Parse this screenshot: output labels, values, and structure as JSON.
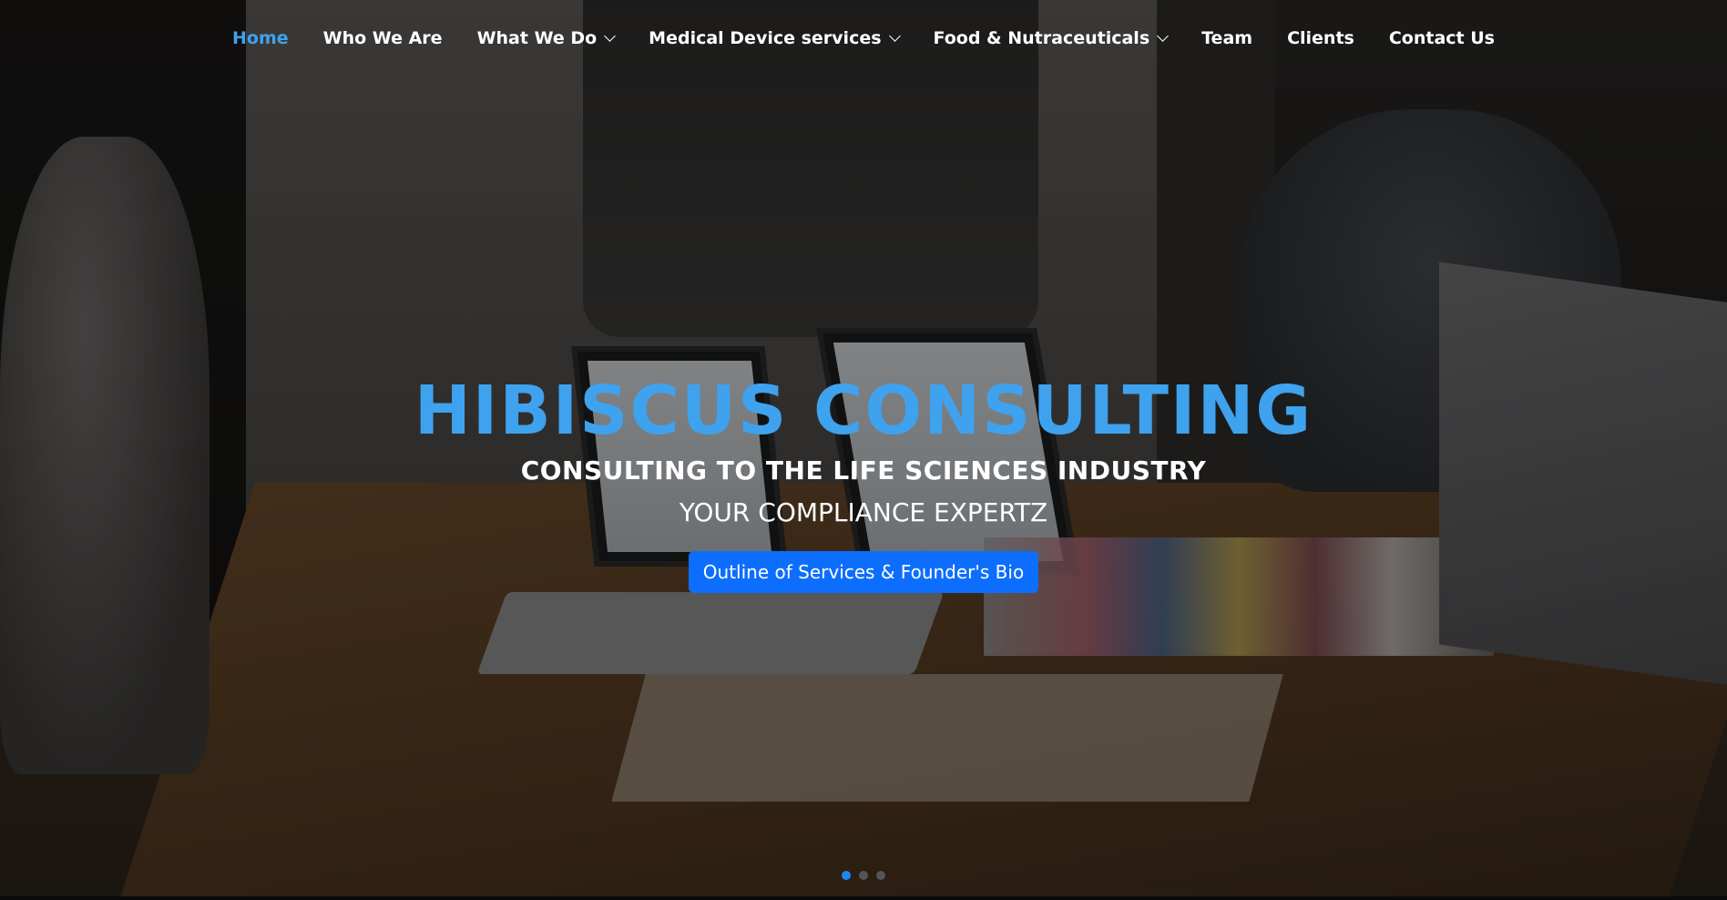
{
  "nav": {
    "items": [
      {
        "label": "Home",
        "active": true,
        "dropdown": false
      },
      {
        "label": "Who We Are",
        "active": false,
        "dropdown": false
      },
      {
        "label": "What We Do",
        "active": false,
        "dropdown": true
      },
      {
        "label": "Medical Device services",
        "active": false,
        "dropdown": true
      },
      {
        "label": "Food & Nutraceuticals",
        "active": false,
        "dropdown": true
      },
      {
        "label": "Team",
        "active": false,
        "dropdown": false
      },
      {
        "label": "Clients",
        "active": false,
        "dropdown": false
      },
      {
        "label": "Contact Us",
        "active": false,
        "dropdown": false
      }
    ]
  },
  "hero": {
    "title": "HIBISCUS CONSULTING",
    "subtitle": "CONSULTING TO THE LIFE SCIENCES INDUSTRY",
    "tagline": "YOUR COMPLIANCE EXPERTZ",
    "cta_label": "Outline of Services & Founder's Bio"
  },
  "carousel": {
    "slide_count": 3,
    "active_index": 0
  },
  "colors": {
    "accent": "#3fa2ee",
    "button": "#0d6efd",
    "indicator_active": "#1e88f0"
  }
}
